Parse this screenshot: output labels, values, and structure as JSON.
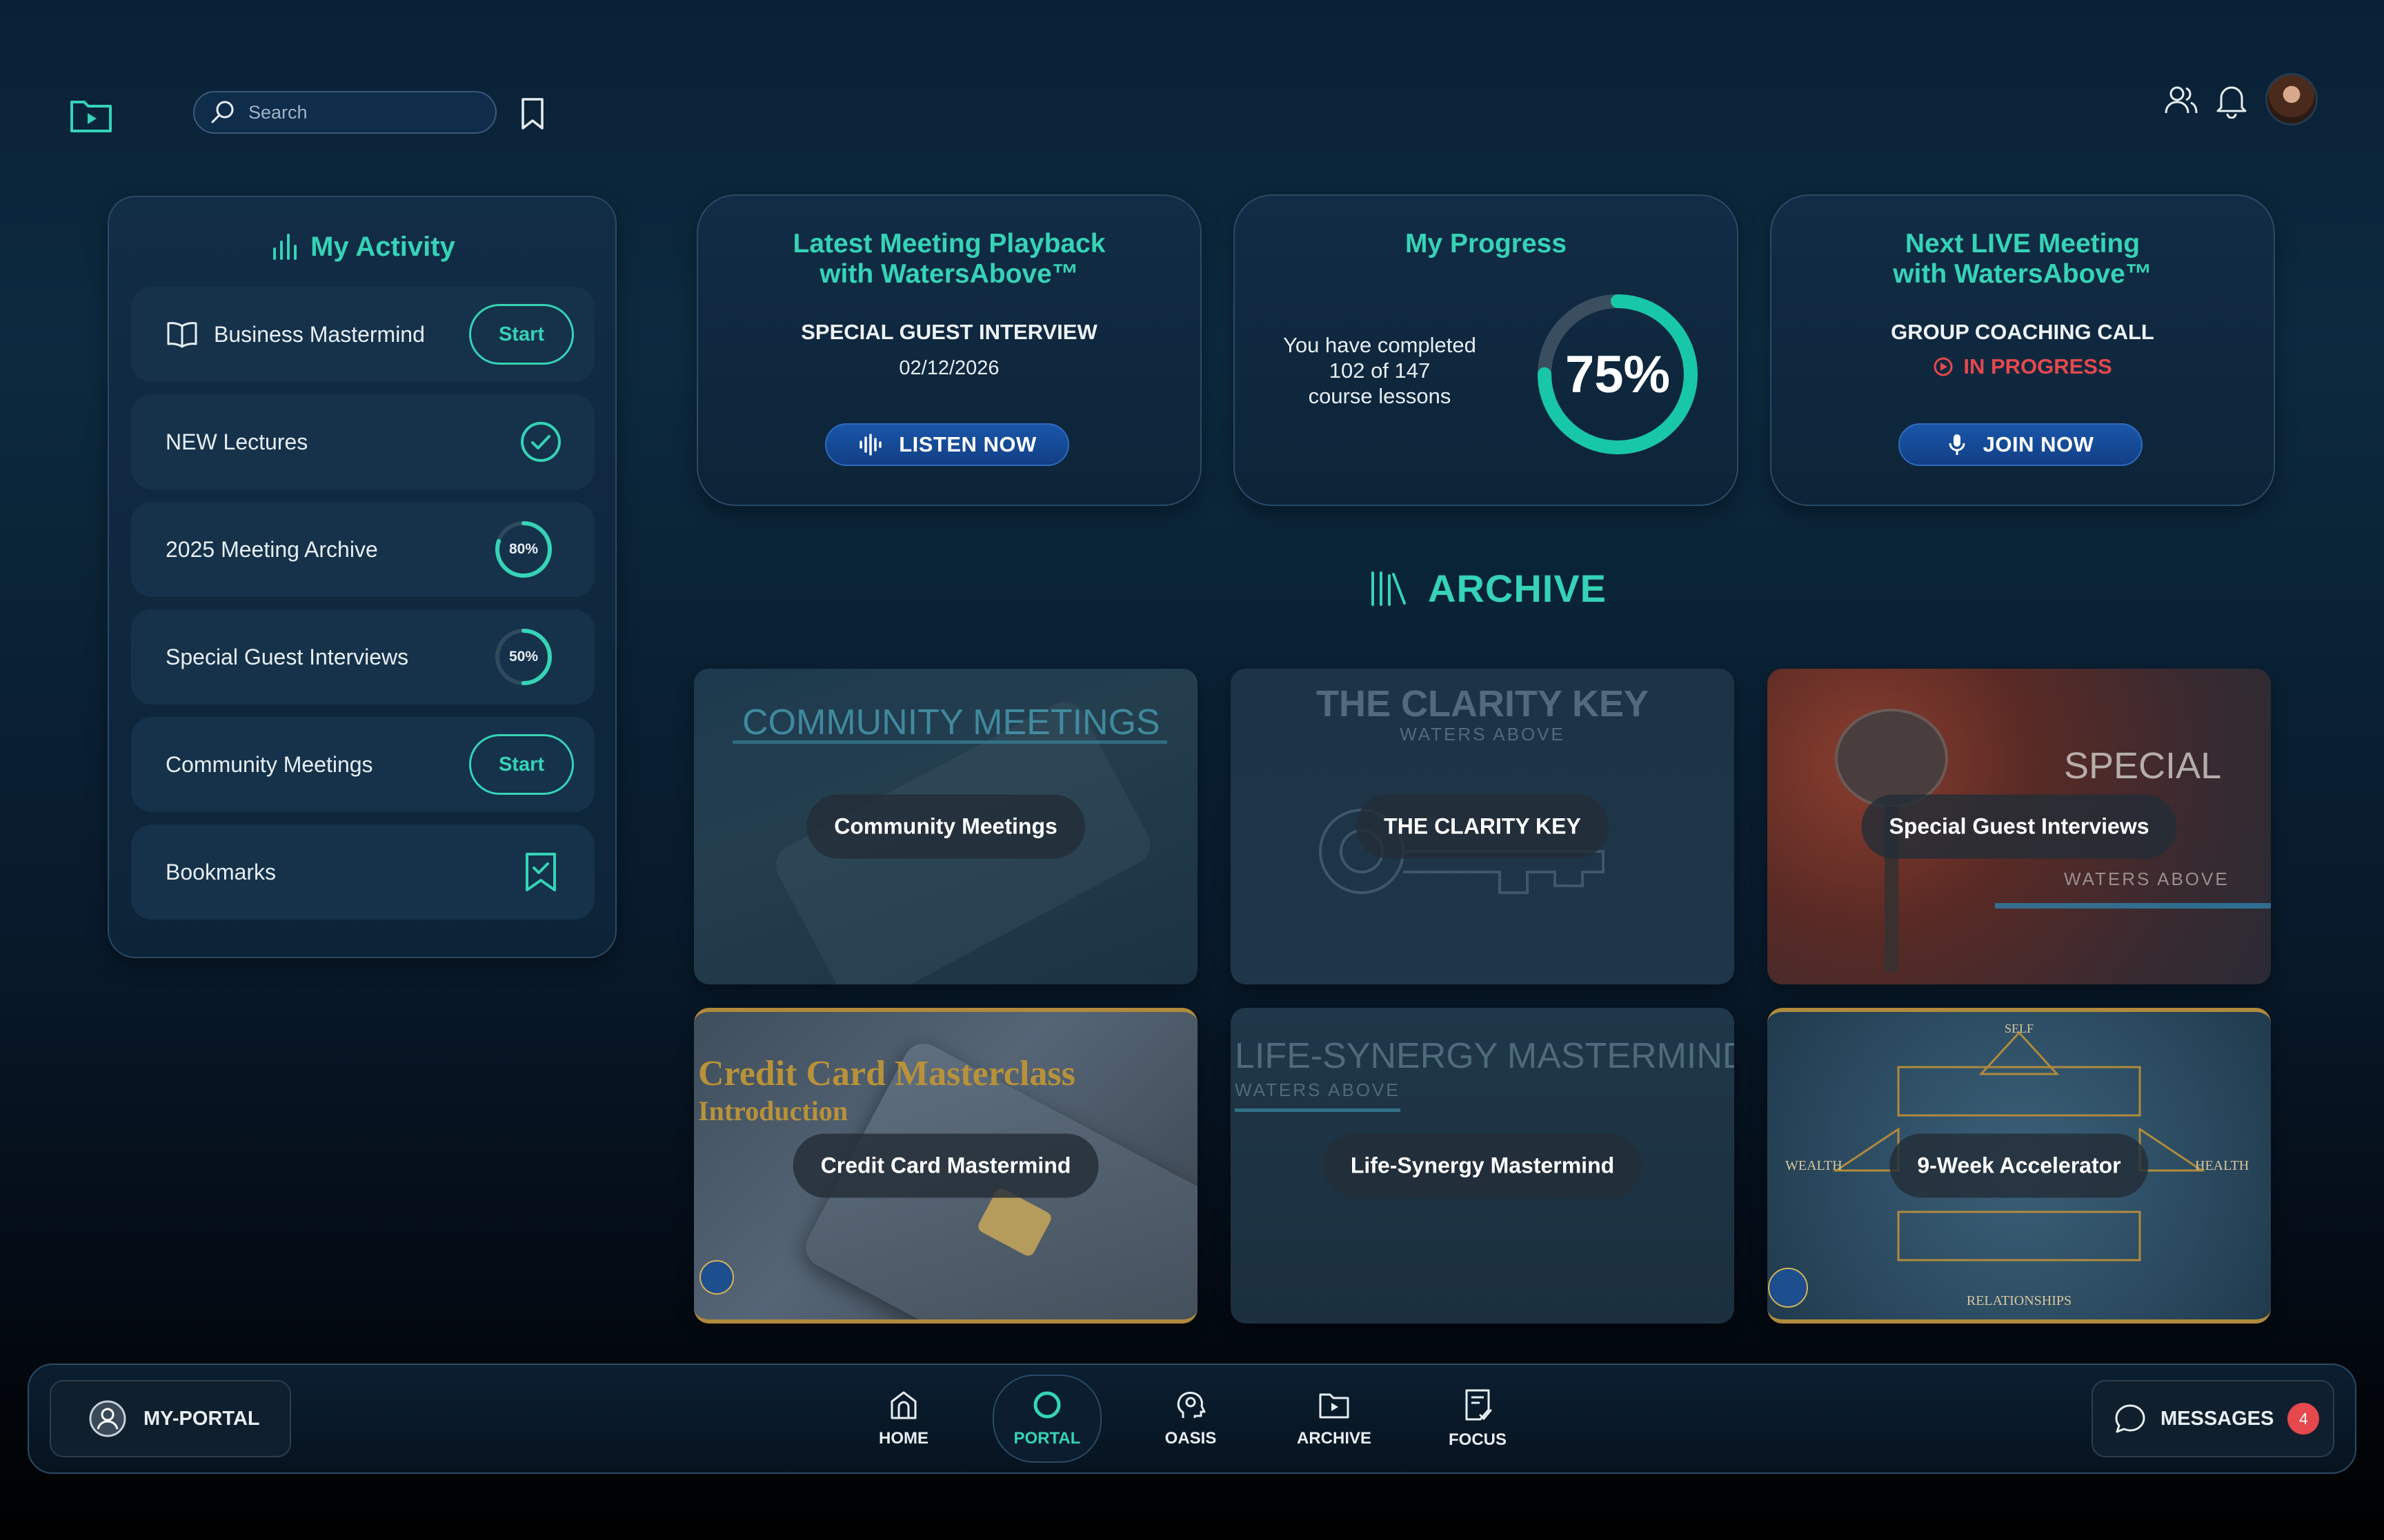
{
  "header": {
    "search_placeholder": "Search"
  },
  "activity": {
    "title": "My Activity",
    "items": [
      {
        "label": "Business Mastermind",
        "action": "Start"
      },
      {
        "label": "NEW Lectures"
      },
      {
        "label": "2025 Meeting Archive",
        "progress": "80%",
        "progress_value": 0.8
      },
      {
        "label": "Special Guest Interviews",
        "progress": "50%",
        "progress_value": 0.5
      },
      {
        "label": "Community Meetings",
        "action": "Start"
      },
      {
        "label": "Bookmarks"
      }
    ]
  },
  "playback": {
    "title_line1": "Latest Meeting Playback",
    "title_line2": "with WatersAbove™",
    "subtitle": "SPECIAL GUEST INTERVIEW",
    "date": "02/12/2026",
    "button": "LISTEN NOW"
  },
  "progress": {
    "title": "My Progress",
    "line1": "You have completed",
    "line2": "102 of 147",
    "line3": "course lessons",
    "percent_label": "75%",
    "percent_value": 0.75
  },
  "live": {
    "title_line1": "Next LIVE Meeting",
    "title_line2": "with WatersAbove™",
    "subtitle": "GROUP COACHING CALL",
    "status": "IN PROGRESS",
    "button": "JOIN NOW"
  },
  "archive": {
    "heading": "ARCHIVE",
    "tiles": [
      {
        "label": "Community Meetings",
        "art": "COMMUNITY MEETINGS"
      },
      {
        "label": "THE CLARITY KEY",
        "art": "THE CLARITY KEY",
        "art_sub": "WATERS ABOVE"
      },
      {
        "label": "Special Guest Interviews",
        "art": "SPECIAL",
        "art_sub": "WATERS ABOVE"
      },
      {
        "label": "Credit Card Mastermind",
        "art": "Credit Card Masterclass",
        "art_sub": "Introduction"
      },
      {
        "label": "Life-Synergy Mastermind",
        "art": "LIFE-SYNERGY MASTERMIND",
        "art_sub": "WATERS ABOVE"
      },
      {
        "label": "9-Week Accelerator",
        "art_top": "SELF",
        "art_left": "WEALTH",
        "art_right": "HEALTH",
        "art_bottom": "RELATIONSHIPS"
      }
    ]
  },
  "nav": {
    "my_portal": "MY-PORTAL",
    "items": [
      "HOME",
      "PORTAL",
      "OASIS",
      "ARCHIVE",
      "FOCUS"
    ],
    "active": "PORTAL",
    "messages": "MESSAGES",
    "messages_count": "4"
  },
  "colors": {
    "accent": "#36d3b6",
    "button_blue": "#1a56a8",
    "live_red": "#e5484d"
  }
}
